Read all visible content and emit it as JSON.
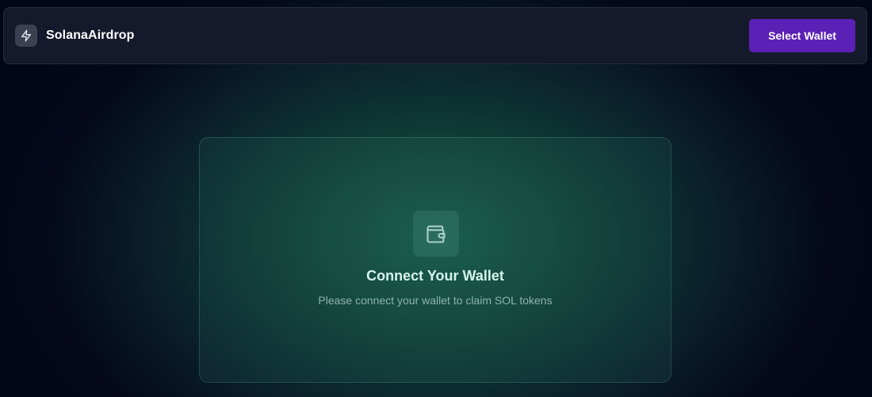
{
  "navbar": {
    "brand_icon": "lightning-icon",
    "brand_name": "SolanaAirdrop",
    "select_wallet_label": "Select Wallet"
  },
  "main": {
    "card": {
      "icon": "wallet-icon",
      "title": "Connect Your Wallet",
      "subtitle": "Please connect your wallet to claim SOL tokens"
    }
  },
  "colors": {
    "accent_button": "#5b21b6",
    "background": "#04081a",
    "glow": "#175848"
  }
}
